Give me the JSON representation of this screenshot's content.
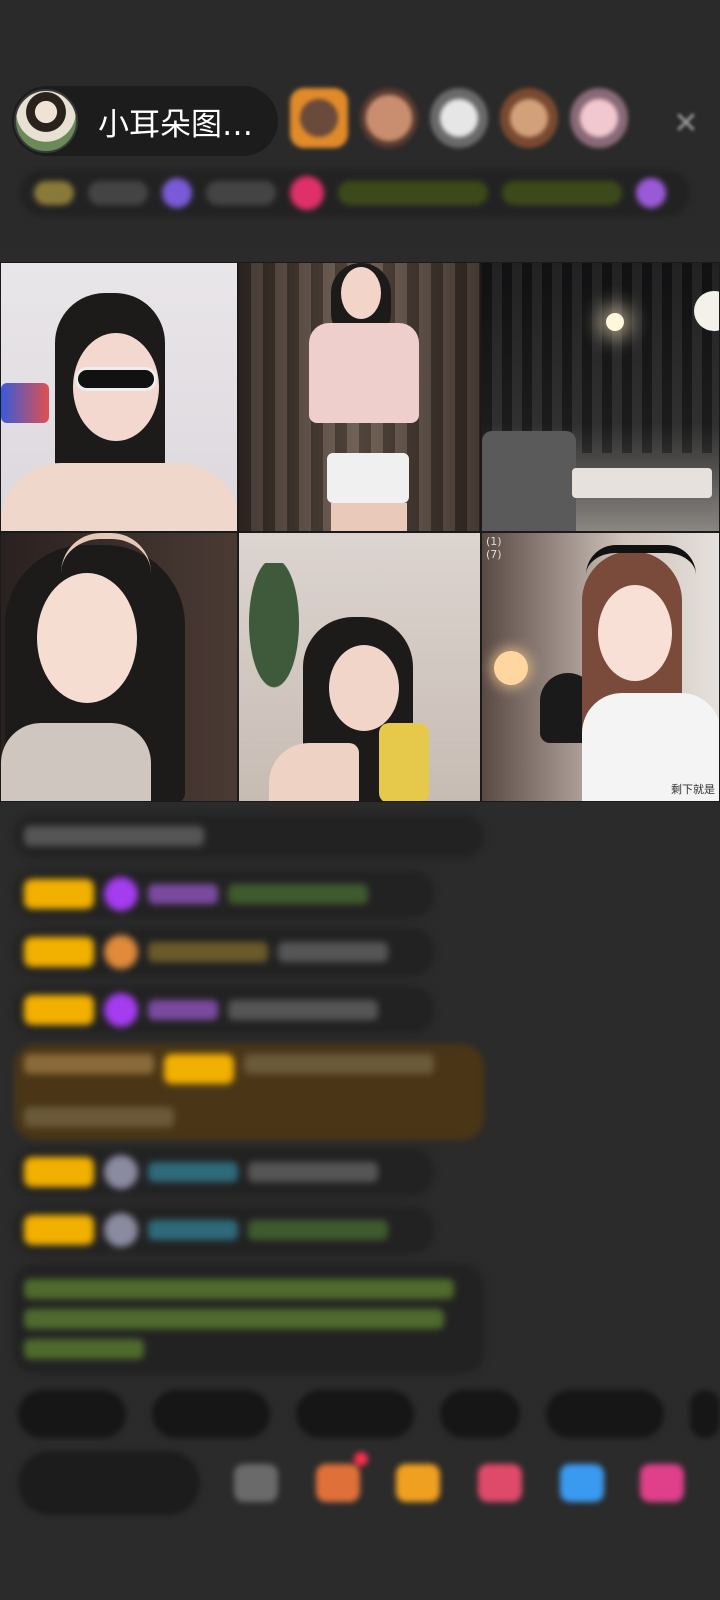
{
  "header": {
    "host_name": "小耳朵图…",
    "viewer_avatars": [
      "viewer-1",
      "viewer-2",
      "viewer-3",
      "viewer-4",
      "viewer-5"
    ],
    "close_icon": "close-icon"
  },
  "colors": {
    "background": "#2b2b2b",
    "vip_tag": "#f2b000",
    "chat_bubble": "#222222",
    "highlight_bubble": "#4a3616",
    "notice_text": "#7cc043"
  },
  "video_grid": {
    "tiles": [
      {
        "id": "tile-1",
        "label": ""
      },
      {
        "id": "tile-2",
        "label": ""
      },
      {
        "id": "tile-3",
        "label": ""
      },
      {
        "id": "tile-4",
        "label": ""
      },
      {
        "id": "tile-5",
        "label": ""
      },
      {
        "id": "tile-6",
        "label_top": "(1)",
        "label_top2": "(7)",
        "label_bottom": "剩下就是"
      }
    ]
  },
  "icons": {
    "gift": "gift-icon",
    "share": "share-icon",
    "more": "more-icon"
  }
}
